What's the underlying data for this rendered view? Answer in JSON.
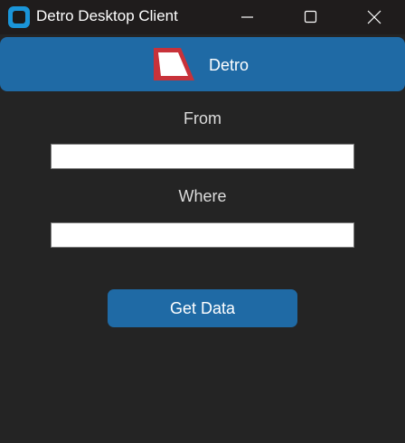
{
  "window": {
    "title": "Detro Desktop Client",
    "controls": {
      "minimize_icon": "minimize-icon",
      "maximize_icon": "maximize-icon",
      "close_icon": "close-icon"
    }
  },
  "header": {
    "logo_icon": "detro-logo-icon",
    "title": "Detro"
  },
  "form": {
    "from_label": "From",
    "from_value": "",
    "where_label": "Where",
    "where_value": "",
    "submit_label": "Get Data"
  },
  "colors": {
    "background": "#242424",
    "titlebar": "#1f1c1c",
    "accent": "#1f6aa5",
    "app_icon": "#1a95d9",
    "logo_red": "#c8323a"
  }
}
